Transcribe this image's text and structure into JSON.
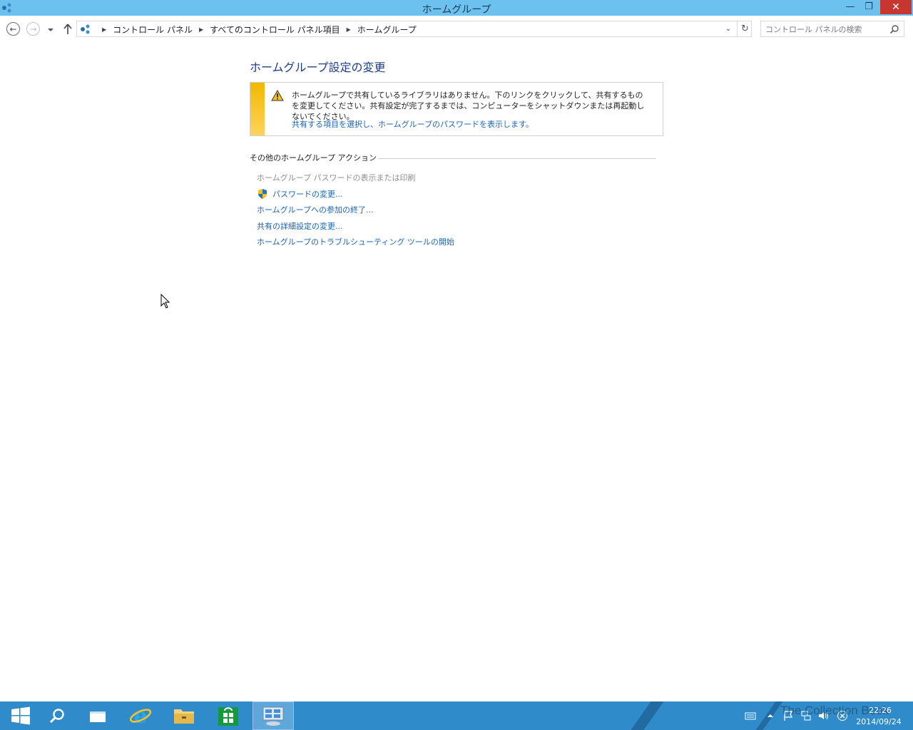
{
  "window": {
    "title": "ホームグループ",
    "minimize_label": "—",
    "maximize_label": "❐",
    "close_label": "✕"
  },
  "address_bar": {
    "breadcrumbs": [
      "コントロール パネル",
      "すべてのコントロール パネル項目",
      "ホームグループ"
    ],
    "search_placeholder": "コントロール パネルの検索"
  },
  "main": {
    "page_title": "ホームグループ設定の変更",
    "info": {
      "message": "ホームグループで共有しているライブラリはありません。下のリンクをクリックして、共有するものを変更してください。共有設定が完了するまでは、コンピューターをシャットダウンまたは再起動しないでください。",
      "link": "共有する項目を選択し、ホームグループのパスワードを表示します。"
    },
    "other_actions_heading": "その他のホームグループ アクション",
    "actions": [
      {
        "label": "ホームグループ パスワードの表示または印刷",
        "enabled": false
      },
      {
        "label": "パスワードの変更...",
        "enabled": true,
        "icon": "shield-icon"
      },
      {
        "label": "ホームグループへの参加の終了...",
        "enabled": true
      },
      {
        "label": "共有の詳細設定の変更...",
        "enabled": true
      },
      {
        "label": "ホームグループのトラブルシューティング ツールの開始",
        "enabled": true
      }
    ]
  },
  "taskbar": {
    "items": [
      "start-icon",
      "search-icon",
      "task-view-icon",
      "internet-explorer-icon",
      "file-explorer-icon",
      "store-icon",
      "control-panel-icon"
    ],
    "clock_time": "22:26",
    "clock_date": "2014/09/24",
    "watermark": "The Collection Book"
  },
  "colors": {
    "titlebar": "#6cc1ee",
    "link": "#1a64b8",
    "title_text": "#1d3e8a",
    "info_stripe": "#f1b900",
    "taskbar": "#2f8bc9",
    "close_button": "#c7372f"
  }
}
